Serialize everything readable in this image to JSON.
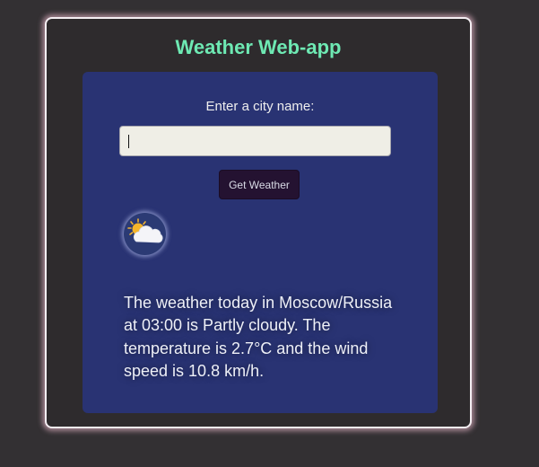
{
  "app": {
    "title": "Weather Web-app"
  },
  "form": {
    "label": "Enter a city name:",
    "input_value": "",
    "input_placeholder": "",
    "button_label": "Get Weather"
  },
  "result": {
    "icon": "partly-cloudy-icon",
    "description": "The weather today in Moscow/Russia at 03:00 is Partly cloudy. The temperature is 2.7°C and the wind speed is 10.8 km/h."
  },
  "colors": {
    "page_background": "#333033",
    "card_background": "#2e2b2d",
    "title_accent": "#6ee9b3",
    "panel_background": "#293373",
    "button_background": "#241231"
  }
}
